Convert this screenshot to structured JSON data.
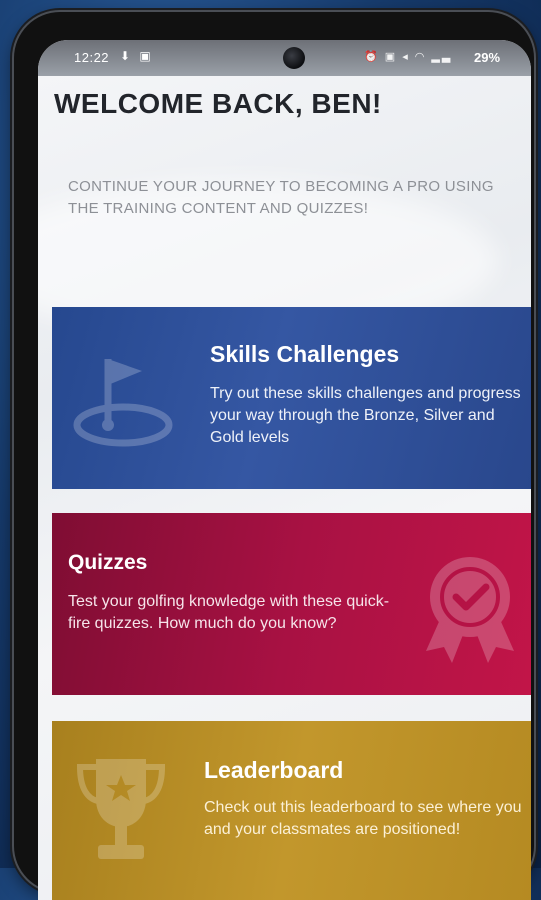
{
  "status_bar": {
    "time": "12:22",
    "left_icons": "⬇ ▣",
    "right_icons": "⏰ ▣ ◂ ◠ ▂▃",
    "battery": "29%"
  },
  "welcome": "WELCOME BACK,  BEN!",
  "intro": "CONTINUE YOUR JOURNEY TO BECOMING A PRO USING THE TRAINING CONTENT AND QUIZZES!",
  "cards": {
    "skills": {
      "title": "Skills Challenges",
      "description": "Try out these skills challenges and progress your way through the Bronze, Silver and Gold levels",
      "icon": "golf-flag-icon",
      "color": "#2c4d96"
    },
    "quizzes": {
      "title": "Quizzes",
      "description": "Test your golfing knowledge with these quick-fire quizzes. How much do you know?",
      "icon": "badge-check-icon",
      "color": "#a81143"
    },
    "leaderboard": {
      "title": "Leaderboard",
      "description": "Check out this leaderboard to see where you and your classmates are positioned!",
      "icon": "trophy-icon",
      "color": "#c2972c"
    }
  }
}
